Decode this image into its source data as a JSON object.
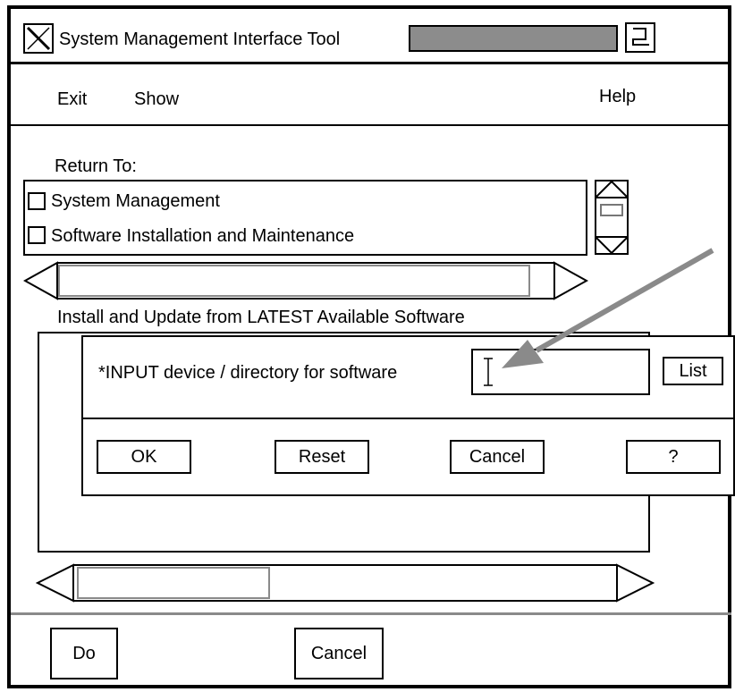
{
  "window": {
    "title": "System Management Interface Tool",
    "progress_color": "#8c8c8c"
  },
  "menubar": {
    "exit_label": "Exit",
    "show_label": "Show",
    "help_label": "Help"
  },
  "return_to": {
    "label": "Return To:",
    "items": [
      {
        "label": "System Management"
      },
      {
        "label": "Software Installation and Maintenance"
      }
    ]
  },
  "install": {
    "heading": "Install and Update from LATEST Available Software"
  },
  "dialog": {
    "field_label": "*INPUT device / directory for software",
    "field_value": "",
    "list_label": "List",
    "ok_label": "OK",
    "reset_label": "Reset",
    "cancel_label": "Cancel",
    "help_label": "?"
  },
  "footer": {
    "do_label": "Do",
    "cancel_label": "Cancel"
  },
  "annotation": {
    "arrow_color": "#8a8a8a"
  }
}
